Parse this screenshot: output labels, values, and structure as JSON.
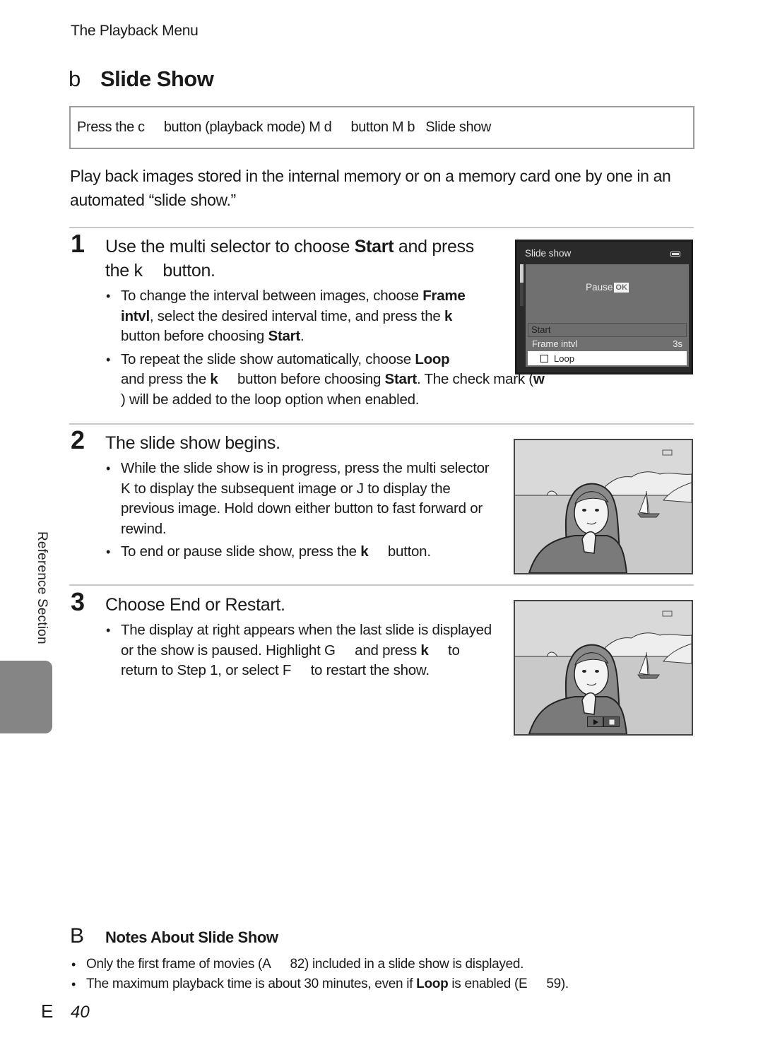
{
  "header": {
    "running_head": "The Playback Menu",
    "title_glyph": "b",
    "title": "Slide Show"
  },
  "navigation_path": {
    "segments": [
      "Press the ",
      "c",
      " button (playback mode) ",
      "M",
      " ",
      "d",
      " button ",
      "M",
      " ",
      "b",
      " Slide show"
    ]
  },
  "intro": "Play back images stored in the internal memory or on a memory card one by one in an automated “slide show.”",
  "steps": [
    {
      "number": "1",
      "heading_parts": [
        "Use the multi selector to choose ",
        "Start",
        " and press the ",
        "k",
        " button."
      ],
      "bullets": [
        [
          "To change the interval between images, choose ",
          "Frame intvl",
          ", select the desired interval time, and press the ",
          "k",
          " button before choosing ",
          "Start",
          "."
        ],
        [
          "To repeat the slide show automatically, choose ",
          "Loop",
          " and press the ",
          "k",
          " button before choosing ",
          "Start",
          ". The check mark (",
          "w",
          ") will be added to the loop option when enabled."
        ]
      ]
    },
    {
      "number": "2",
      "heading": "The slide show begins.",
      "bullets": [
        [
          "While the slide show is in progress, press the multi selector ",
          "K",
          " to display the subsequent image or ",
          "J",
          " to display the previous image. Hold down either button to fast forward or rewind."
        ],
        [
          "To end or pause slide show, press the ",
          "k",
          " button."
        ]
      ]
    },
    {
      "number": "3",
      "heading": "Choose End or Restart.",
      "bullets": [
        [
          "The display at right appears when the last slide is displayed or the show is paused. Highlight ",
          "G",
          " and press ",
          "k",
          " to return to Step 1, or select ",
          "F",
          " to restart the show."
        ]
      ]
    }
  ],
  "camera_menu": {
    "title": "Slide show",
    "pause_label": "Pause",
    "ok_badge": "OK",
    "items": [
      {
        "label": "Start",
        "value": ""
      },
      {
        "label": "Frame intvl",
        "value": "3s"
      },
      {
        "label": "Loop",
        "value": "",
        "checked": false
      }
    ],
    "colors": {
      "screen": "#2a2a2a",
      "panel": "#707070",
      "highlight": "#ffffff"
    }
  },
  "illustrations": {
    "step2": "woman-by-lake-with-sailboat",
    "step3": "woman-by-lake-with-sailboat-and-playback-controls",
    "controls": [
      "play-icon",
      "stop-icon"
    ]
  },
  "side_tab": {
    "label": "Reference Section",
    "color": "#858585"
  },
  "notes": {
    "glyph": "B",
    "title": "Notes About Slide Show",
    "items": [
      [
        "Only the first frame of movies (",
        "A",
        " 82) included in a slide show is displayed."
      ],
      [
        "The maximum playback time is about 30 minutes, even if ",
        "Loop",
        " is enabled (",
        "E",
        " 59)."
      ]
    ]
  },
  "folio": {
    "letter": "E",
    "number": "40"
  }
}
